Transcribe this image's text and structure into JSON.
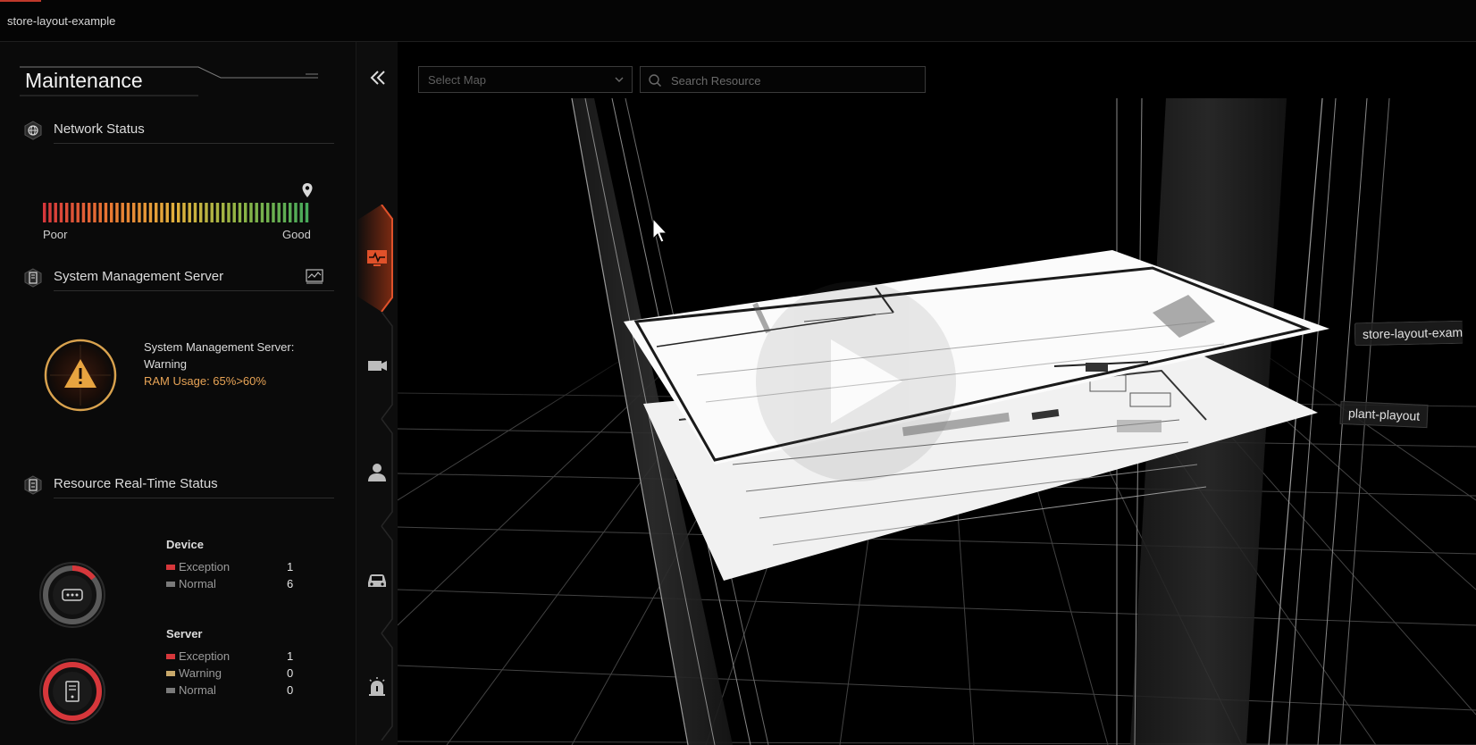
{
  "window": {
    "title": "store-layout-example"
  },
  "panel": {
    "title": "Maintenance",
    "network": {
      "label": "Network Status",
      "scale_low": "Poor",
      "scale_high": "Good",
      "level": 1.0
    },
    "server": {
      "label": "System Management Server",
      "status_line": "System Management Server: Warning",
      "ram_line": "RAM Usage: 65%>60%"
    },
    "resources": {
      "label": "Resource Real-Time Status",
      "device": {
        "title": "Device",
        "rows": [
          {
            "name": "Exception",
            "count": "1",
            "color": "#d6373b"
          },
          {
            "name": "Normal",
            "count": "6",
            "color": "#7a7a7a"
          }
        ]
      },
      "server": {
        "title": "Server",
        "rows": [
          {
            "name": "Exception",
            "count": "1",
            "color": "#d6373b"
          },
          {
            "name": "Warning",
            "count": "0",
            "color": "#c8a86a"
          },
          {
            "name": "Normal",
            "count": "0",
            "color": "#7a7a7a"
          }
        ]
      }
    }
  },
  "nav": {
    "items": [
      {
        "icon": "monitor-pulse-icon",
        "active": true
      },
      {
        "icon": "camera-icon",
        "active": false
      },
      {
        "icon": "person-icon",
        "active": false
      },
      {
        "icon": "car-icon",
        "active": false
      },
      {
        "icon": "alarm-icon",
        "active": false
      }
    ]
  },
  "toolbar": {
    "map_placeholder": "Select Map",
    "search_placeholder": "Search Resource"
  },
  "scene": {
    "map_labels": [
      "store-layout-exam",
      "plant-playout"
    ]
  },
  "colors": {
    "accent": "#e0512a",
    "exception": "#d6373b",
    "warning": "#e8a456",
    "normal": "#7a7a7a"
  }
}
